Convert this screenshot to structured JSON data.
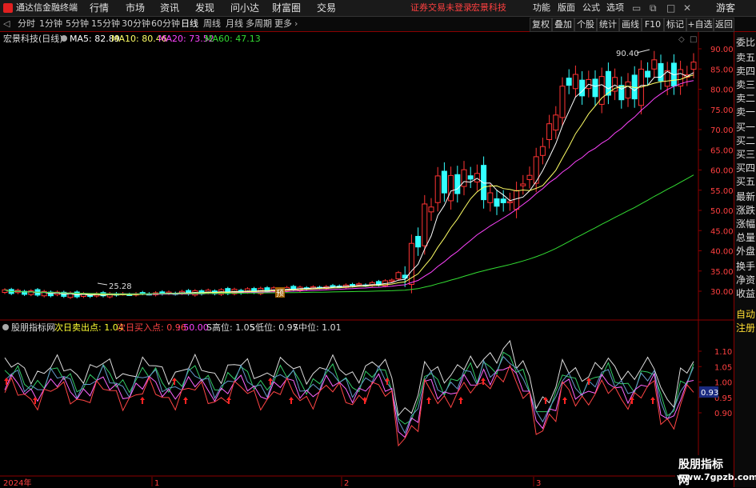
{
  "menu": {
    "app_title": "通达信金融终端",
    "items": [
      "行情",
      "市场",
      "资讯",
      "发现",
      "问小达",
      "财富圈",
      "交易"
    ],
    "notice_login": "证券交易未登录",
    "notice_stock": "宏景科技",
    "right_items": [
      "功能",
      "版面",
      "公式",
      "选项"
    ],
    "guest": "游客"
  },
  "timeframes": [
    "分时",
    "1分钟",
    "5分钟",
    "15分钟",
    "30分钟",
    "60分钟",
    "日线",
    "周线",
    "月线",
    "多周期",
    "更多"
  ],
  "active_timeframe": "日线",
  "right_buttons": [
    "复权",
    "叠加",
    "个股",
    "统计",
    "画线",
    "F10",
    "标记",
    "+自选",
    "返回"
  ],
  "main_header": {
    "stock": "宏景科技(日线)",
    "ma": [
      {
        "label": "MA5: 82.89",
        "color": "#ffffff"
      },
      {
        "label": "MA10: 80.46",
        "color": "#ffff66"
      },
      {
        "label": "MA20: 73.52",
        "color": "#ff44ff"
      },
      {
        "label": "MA60: 47.13",
        "color": "#33dd33"
      }
    ]
  },
  "main_axis": {
    "ticks": [
      "90.00",
      "85.00",
      "80.00",
      "75.00",
      "70.00",
      "65.00",
      "60.00",
      "55.00",
      "50.00",
      "45.00",
      "40.00",
      "35.00",
      "30.00"
    ]
  },
  "annotations": {
    "high": "90.40",
    "low": "25.28",
    "badge": "预"
  },
  "indicator_header": {
    "name": "股朋指标网",
    "items": [
      {
        "label": "次日卖出点: 1.04",
        "color": "#ffff33"
      },
      {
        "label": "次日买入点: 0.96",
        "color": "#ff4444"
      },
      {
        "label": ": 50.00",
        "color": "#ff44ff"
      },
      {
        "label": "S高位: 1.05",
        "color": "#dddddd"
      },
      {
        "label": "S低位: 0.97",
        "color": "#dddddd"
      },
      {
        "label": "S中位: 1.01",
        "color": "#dddddd"
      }
    ]
  },
  "ind_axis": {
    "ticks": [
      "1.10",
      "1.05",
      "1.00",
      "0.95",
      "0.90"
    ],
    "current": "0.93"
  },
  "side_labels": [
    "委比",
    "卖五",
    "卖四",
    "卖三",
    "卖二",
    "卖一",
    "买一",
    "买二",
    "买三",
    "买四",
    "买五",
    "最新",
    "涨跌",
    "涨幅",
    "总量",
    "外盘",
    "换手",
    "净资",
    "收益"
  ],
  "side_buttons": [
    "自动",
    "注册"
  ],
  "date_axis": [
    "2024年",
    "1",
    "2",
    "3"
  ],
  "watermark": {
    "name": "股朋指标网",
    "url": "www.7gpzb.com"
  },
  "colors": {
    "up": "#ff3333",
    "down": "#33ffff",
    "ma5": "#ffffff",
    "ma10": "#ffff66",
    "ma20": "#ff44ff",
    "ma60": "#33dd33"
  }
}
